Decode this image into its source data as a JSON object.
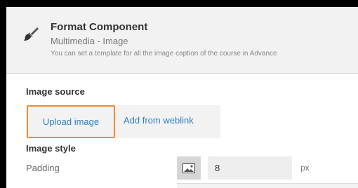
{
  "header": {
    "title": "Format Component",
    "subtitle": "Multimedia - Image",
    "description": "You can set a template for all the image caption of the course in Advance"
  },
  "image_source": {
    "label": "Image source",
    "tabs": [
      {
        "label": "Upload image",
        "selected": true
      },
      {
        "label": "Add from weblink",
        "selected": false
      }
    ]
  },
  "image_style": {
    "label": "Image style",
    "padding_label": "Padding",
    "padding_value": "8",
    "padding_unit": "px"
  },
  "icons": {
    "header_icon": "paintbrush-icon",
    "padding_icon": "image-icon"
  },
  "colors": {
    "highlight": "#ef8c32",
    "link": "#2f80c6",
    "header_background": "#f2f2f2"
  }
}
